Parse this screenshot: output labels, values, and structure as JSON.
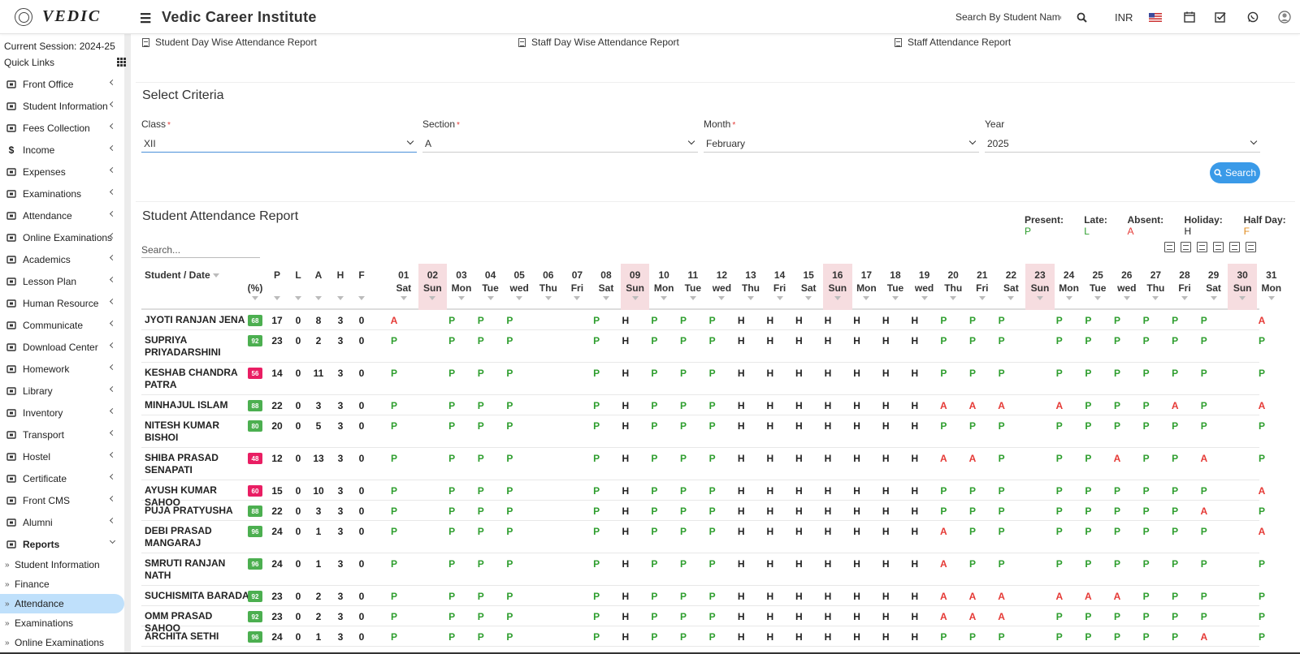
{
  "header": {
    "brand": "VEDIC",
    "institute": "Vedic Career Institute",
    "search_placeholder": "Search By Student Name",
    "currency": "INR"
  },
  "sidebar": {
    "session": "Current Session: 2024-25",
    "quick_links": "Quick Links",
    "items": [
      {
        "label": "Front Office",
        "icon": "front-office-icon"
      },
      {
        "label": "Student Information",
        "icon": "user-plus-icon"
      },
      {
        "label": "Fees Collection",
        "icon": "money-icon"
      },
      {
        "label": "Income",
        "icon": "dollar-icon"
      },
      {
        "label": "Expenses",
        "icon": "card-icon"
      },
      {
        "label": "Examinations",
        "icon": "map-icon"
      },
      {
        "label": "Attendance",
        "icon": "calendar-check-icon"
      },
      {
        "label": "Online Examinations",
        "icon": "rss-icon"
      },
      {
        "label": "Academics",
        "icon": "graduation-cap-icon"
      },
      {
        "label": "Lesson Plan",
        "icon": "list-icon"
      },
      {
        "label": "Human Resource",
        "icon": "sitemap-icon"
      },
      {
        "label": "Communicate",
        "icon": "bullhorn-icon"
      },
      {
        "label": "Download Center",
        "icon": "download-icon"
      },
      {
        "label": "Homework",
        "icon": "flask-icon"
      },
      {
        "label": "Library",
        "icon": "book-icon"
      },
      {
        "label": "Inventory",
        "icon": "barcode-icon"
      },
      {
        "label": "Transport",
        "icon": "bus-icon"
      },
      {
        "label": "Hostel",
        "icon": "building-icon"
      },
      {
        "label": "Certificate",
        "icon": "certificate-icon"
      },
      {
        "label": "Front CMS",
        "icon": "empire-icon"
      },
      {
        "label": "Alumni",
        "icon": "globe-icon"
      },
      {
        "label": "Reports",
        "icon": "line-chart-icon"
      }
    ],
    "sub_items": [
      "Student Information",
      "Finance",
      "Attendance",
      "Examinations",
      "Online Examinations"
    ],
    "active_sub": "Attendance"
  },
  "report_links": [
    "Student Day Wise Attendance Report",
    "Staff Day Wise Attendance Report",
    "Staff Attendance Report"
  ],
  "criteria": {
    "title": "Select Criteria",
    "class_label": "Class",
    "class_value": "XII",
    "section_label": "Section",
    "section_value": "A",
    "month_label": "Month",
    "month_value": "February",
    "year_label": "Year",
    "year_value": "2025",
    "search_button": "Search",
    "required_mark": "*"
  },
  "report": {
    "title": "Student Attendance Report",
    "legend": [
      {
        "label": "Present:",
        "key": "P",
        "color": "#2e9e2e"
      },
      {
        "label": "Late:",
        "key": "L",
        "color": "#2e9e2e"
      },
      {
        "label": "Absent:",
        "key": "A",
        "color": "#e53935"
      },
      {
        "label": "Holiday:",
        "key": "H",
        "color": "#222"
      },
      {
        "label": "Half Day:",
        "key": "F",
        "color": "#e0891a"
      }
    ],
    "search_placeholder": "Search...",
    "col_student": "Student / Date",
    "col_pct": "(%)",
    "stat_cols": [
      "P",
      "L",
      "A",
      "H",
      "F"
    ],
    "days": [
      [
        "01",
        "Sat"
      ],
      [
        "02",
        "Sun"
      ],
      [
        "03",
        "Mon"
      ],
      [
        "04",
        "Tue"
      ],
      [
        "05",
        "wed"
      ],
      [
        "06",
        "Thu"
      ],
      [
        "07",
        "Fri"
      ],
      [
        "08",
        "Sat"
      ],
      [
        "09",
        "Sun"
      ],
      [
        "10",
        "Mon"
      ],
      [
        "11",
        "Tue"
      ],
      [
        "12",
        "wed"
      ],
      [
        "13",
        "Thu"
      ],
      [
        "14",
        "Fri"
      ],
      [
        "15",
        "Sat"
      ],
      [
        "16",
        "Sun"
      ],
      [
        "17",
        "Mon"
      ],
      [
        "18",
        "Tue"
      ],
      [
        "19",
        "wed"
      ],
      [
        "20",
        "Thu"
      ],
      [
        "21",
        "Fri"
      ],
      [
        "22",
        "Sat"
      ],
      [
        "23",
        "Sun"
      ],
      [
        "24",
        "Mon"
      ],
      [
        "25",
        "Tue"
      ],
      [
        "26",
        "wed"
      ],
      [
        "27",
        "Thu"
      ],
      [
        "28",
        "Fri"
      ],
      [
        "29",
        "Sat"
      ],
      [
        "30",
        "Sun"
      ],
      [
        "31",
        "Mon"
      ]
    ],
    "rows": [
      {
        "name": "JYOTI RANJAN JENA",
        "pct": "68",
        "color": "g",
        "stats": [
          "17",
          "0",
          "8",
          "3",
          "0"
        ],
        "marks": "A,,P,P,P,,,P,H,P,P,P,H,H,H,H,H,H,H,P,P,P,,P,P,P,P,P,P,,A"
      },
      {
        "name": "SUPRIYA PRIYADARSHINI",
        "pct": "92",
        "color": "g",
        "stats": [
          "23",
          "0",
          "2",
          "3",
          "0"
        ],
        "marks": "P,,P,P,P,,,P,H,P,P,P,H,H,H,H,H,H,H,P,P,P,,P,P,P,P,P,P,,P"
      },
      {
        "name": "KESHAB CHANDRA PATRA",
        "pct": "56",
        "color": "r",
        "stats": [
          "14",
          "0",
          "11",
          "3",
          "0"
        ],
        "marks": "P,,P,P,P,,,P,H,P,P,P,H,H,H,H,H,H,H,P,P,P,,P,P,P,P,P,P,,P"
      },
      {
        "name": "MINHAJUL ISLAM",
        "pct": "88",
        "color": "g",
        "stats": [
          "22",
          "0",
          "3",
          "3",
          "0"
        ],
        "marks": "P,,P,P,P,,,P,H,P,P,P,H,H,H,H,H,H,H,A,A,A,,A,P,P,P,A,P,,A"
      },
      {
        "name": "NITESH KUMAR BISHOI",
        "pct": "80",
        "color": "g",
        "stats": [
          "20",
          "0",
          "5",
          "3",
          "0"
        ],
        "marks": "P,,P,P,P,,,P,H,P,P,P,H,H,H,H,H,H,H,P,P,P,,P,P,P,P,P,P,,P"
      },
      {
        "name": "SHIBA PRASAD SENAPATI",
        "pct": "48",
        "color": "r",
        "stats": [
          "12",
          "0",
          "13",
          "3",
          "0"
        ],
        "marks": "P,,P,P,P,,,P,H,P,P,P,H,H,H,H,H,H,H,A,A,P,,P,P,A,P,P,A,,P"
      },
      {
        "name": "AYUSH KUMAR SAHOO",
        "pct": "60",
        "color": "r",
        "stats": [
          "15",
          "0",
          "10",
          "3",
          "0"
        ],
        "marks": "P,,P,P,P,,,P,H,P,P,P,H,H,H,H,H,H,H,P,P,P,,P,P,P,P,P,P,,A"
      },
      {
        "name": "PUJA PRATYUSHA",
        "pct": "88",
        "color": "g",
        "stats": [
          "22",
          "0",
          "3",
          "3",
          "0"
        ],
        "marks": "P,,P,P,P,,,P,H,P,P,P,H,H,H,H,H,H,H,P,P,P,,P,P,P,P,P,A,,P"
      },
      {
        "name": "DEBI PRASAD MANGARAJ",
        "pct": "96",
        "color": "g",
        "stats": [
          "24",
          "0",
          "1",
          "3",
          "0"
        ],
        "marks": "P,,P,P,P,,,P,H,P,P,P,H,H,H,H,H,H,H,A,P,P,,P,P,P,P,P,P,,A"
      },
      {
        "name": "SMRUTI RANJAN NATH",
        "pct": "96",
        "color": "g",
        "stats": [
          "24",
          "0",
          "1",
          "3",
          "0"
        ],
        "marks": "P,,P,P,P,,,P,H,P,P,P,H,H,H,H,H,H,H,A,P,P,,P,P,P,P,P,P,,P"
      },
      {
        "name": "SUCHISMITA BARADA",
        "pct": "92",
        "color": "g",
        "stats": [
          "23",
          "0",
          "2",
          "3",
          "0"
        ],
        "marks": "P,,P,P,P,,,P,H,P,P,P,H,H,H,H,H,H,H,A,A,A,,A,A,A,P,P,P,,P"
      },
      {
        "name": "OMM PRASAD SAHOO",
        "pct": "92",
        "color": "g",
        "stats": [
          "23",
          "0",
          "2",
          "3",
          "0"
        ],
        "marks": "P,,P,P,P,,,P,H,P,P,P,H,H,H,H,H,H,H,A,A,A,,P,P,P,P,P,P,,P"
      },
      {
        "name": "ARCHITA SETHI",
        "pct": "96",
        "color": "g",
        "stats": [
          "24",
          "0",
          "1",
          "3",
          "0"
        ],
        "marks": "P,,P,P,P,,,P,H,P,P,P,H,H,H,H,H,H,H,P,P,P,,P,P,P,P,P,A,,P"
      }
    ]
  }
}
